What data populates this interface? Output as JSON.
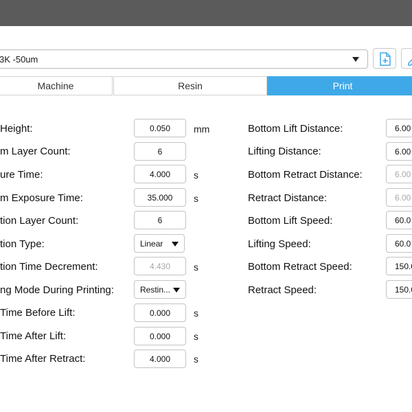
{
  "profile": {
    "selected": "3K -50um"
  },
  "tabs": [
    {
      "label": "Machine"
    },
    {
      "label": "Resin"
    },
    {
      "label": "Print",
      "active": true
    }
  ],
  "left": [
    {
      "label": "Height:",
      "value": "0.050",
      "unit": "mm"
    },
    {
      "label": "m Layer Count:",
      "value": "6",
      "unit": ""
    },
    {
      "label": "ure Time:",
      "value": "4.000",
      "unit": "s"
    },
    {
      "label": "m Exposure Time:",
      "value": "35.000",
      "unit": "s"
    },
    {
      "label": "tion Layer Count:",
      "value": "6",
      "unit": ""
    },
    {
      "label": "tion Type:",
      "value": "Linear",
      "unit": ""
    },
    {
      "label": "tion Time Decrement:",
      "value": "4.430",
      "unit": "s"
    },
    {
      "label": "ng Mode During Printing:",
      "value": "Restin...",
      "unit": ""
    },
    {
      "label": "Time Before Lift:",
      "value": "0.000",
      "unit": "s"
    },
    {
      "label": "Time After Lift:",
      "value": "0.000",
      "unit": "s"
    },
    {
      "label": "Time After Retract:",
      "value": "4.000",
      "unit": "s"
    }
  ],
  "right": [
    {
      "label": "Bottom Lift Distance:",
      "value": "6.00"
    },
    {
      "label": "Lifting Distance:",
      "value": "6.00"
    },
    {
      "label": "Bottom Retract Distance:",
      "value": "6.00"
    },
    {
      "label": "Retract Distance:",
      "value": "6.00"
    },
    {
      "label": "Bottom Lift Speed:",
      "value": "60.0"
    },
    {
      "label": "Lifting Speed:",
      "value": "60.0"
    },
    {
      "label": "Bottom Retract Speed:",
      "value": "150.0"
    },
    {
      "label": "Retract Speed:",
      "value": "150.0"
    }
  ],
  "icons": {
    "new_file": "file-plus-icon",
    "edit": "pencil-icon"
  },
  "colors": {
    "accent": "#3fa9e8",
    "titlebar": "#5b5b5b"
  }
}
